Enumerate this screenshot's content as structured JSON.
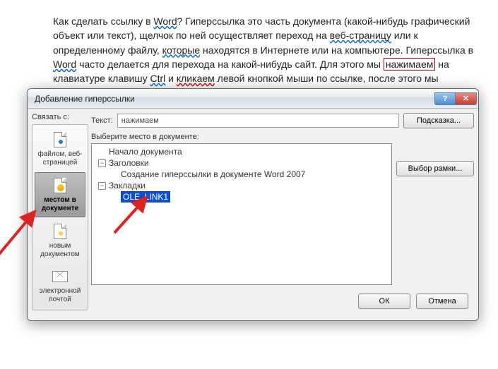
{
  "document": {
    "paragraph_parts": [
      {
        "t": "Как сделать ссылку в "
      },
      {
        "t": "Word",
        "cls": "wavy-blue"
      },
      {
        "t": "? Гиперссылка это часть документа (какой-нибудь графический объект или текст), щелчок по ней осуществляет переход на "
      },
      {
        "t": "веб-страницу",
        "cls": "wavy-blue"
      },
      {
        "t": " или к определенному файлу, "
      },
      {
        "t": "которые",
        "cls": "wavy-blue"
      },
      {
        "t": " находятся в Интернете или на компьютере. Гиперссылка в "
      },
      {
        "t": "Word",
        "cls": "wavy-blue"
      },
      {
        "t": " часто делается  для перехода на какой-нибудь сайт. Для этого мы "
      },
      {
        "t": "нажимаем",
        "cls": "boxed-red"
      },
      {
        "t": " на клавиатуре клавишу "
      },
      {
        "t": "Ctrl",
        "cls": "wavy-blue"
      },
      {
        "t": " и "
      },
      {
        "t": "кликаем",
        "cls": "wavy-red"
      },
      {
        "t": " левой кнопкой мыши по ссылке, после этого мы автоматически попадаем на нужный нам сайт или"
      }
    ]
  },
  "dialog": {
    "title": "Добавление гиперссылки",
    "connect_label": "Связать с:",
    "text_label": "Текст:",
    "text_value": "нажимаем",
    "hint_btn": "Подсказка...",
    "select_label": "Выберите место в документе:",
    "frame_btn": "Выбор рамки...",
    "ok": "ОК",
    "cancel": "Отмена",
    "sidebar": [
      {
        "label": "файлом, веб-страницей"
      },
      {
        "label": "местом в документе"
      },
      {
        "label": "новым документом"
      },
      {
        "label": "электронной почтой"
      }
    ],
    "tree": {
      "root": "Начало документа",
      "headings": "Заголовки",
      "heading_item": "Создание гиперссылки в документе Word 2007",
      "bookmarks": "Закладки",
      "bookmark_item": "OLE_LINK1"
    }
  }
}
